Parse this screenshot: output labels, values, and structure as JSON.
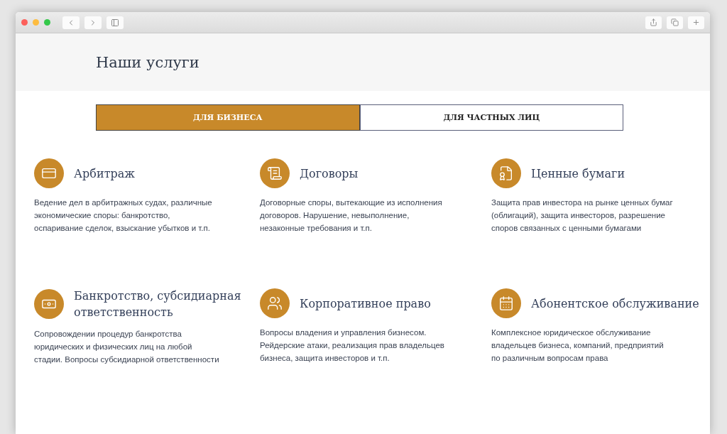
{
  "page": {
    "title": "Наши услуги"
  },
  "tabs": [
    {
      "label": "ДЛЯ БИЗНЕСА",
      "selected": true
    },
    {
      "label": "ДЛЯ ЧАСТНЫХ ЛИЦ",
      "selected": false
    }
  ],
  "services": [
    {
      "title": "Арбитраж",
      "description": "Ведение дел в арбитражных судах, различные\nэкономические споры: банкротство,\nоспаривание сделок, взыскание убытков и т.п."
    },
    {
      "title": "Договоры",
      "description": "Договорные споры, вытекающие из исполнения\nдоговоров. Нарушение, невыполнение,\nнезаконные требования и т.п."
    },
    {
      "title": "Ценные бумаги",
      "description": "Защита прав инвестора на рынке ценных бумаг\n(облигаций), защита инвесторов, разрешение\nспоров связанных с ценными бумагами"
    },
    {
      "title": "Банкротство, субсидиарная ответственность",
      "description": "Сопровождении процедур банкротства\nюридических и физических лиц на любой\nстадии. Вопросы субсидиарной ответственности"
    },
    {
      "title": "Корпоративное право",
      "description": "Вопросы владения и управления бизнесом.\nРейдерские атаки, реализация прав владельцев\nбизнеса, защита инвесторов и т.п."
    },
    {
      "title": "Абонентское обслуживание",
      "description": "Комплексное юридическое обслуживание\nвладельцев бизнеса, компаний, предприятий\nпо различным вопросам права"
    }
  ]
}
